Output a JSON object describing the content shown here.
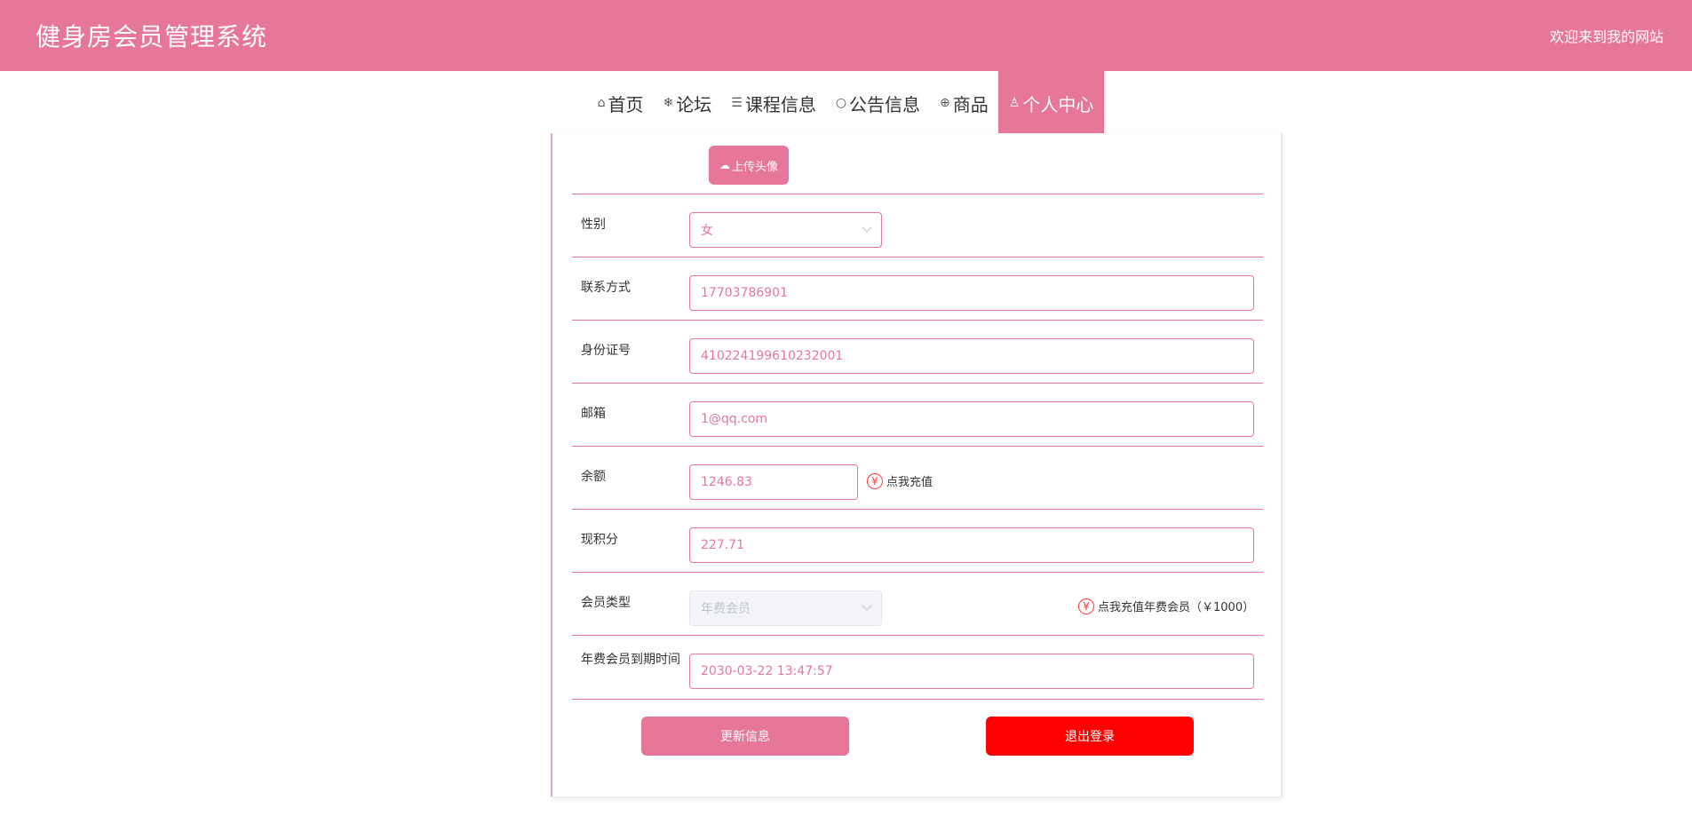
{
  "header": {
    "title": "健身房会员管理系统",
    "welcome": "欢迎来到我的网站"
  },
  "nav": [
    {
      "icon": "⌂",
      "label": "首页"
    },
    {
      "icon": "❄",
      "label": "论坛"
    },
    {
      "icon": "☰",
      "label": "课程信息"
    },
    {
      "icon": "○",
      "label": "公告信息"
    },
    {
      "icon": "⊕",
      "label": "商品"
    },
    {
      "icon": "♙",
      "label": "个人中心"
    }
  ],
  "profile": {
    "upload_label": "上传头像",
    "gender": {
      "label": "性别",
      "value": "女"
    },
    "phone": {
      "label": "联系方式",
      "value": "17703786901"
    },
    "id_card": {
      "label": "身份证号",
      "value": "410224199610232001"
    },
    "email": {
      "label": "邮箱",
      "value": "1@qq.com"
    },
    "balance": {
      "label": "余额",
      "value": "1246.83",
      "recharge": "点我充值"
    },
    "points": {
      "label": "现积分",
      "value": "227.71"
    },
    "member_type": {
      "label": "会员类型",
      "value": "年费会员",
      "recharge": "点我充值年费会员（￥1000）"
    },
    "expire": {
      "label": "年费会员到期时间",
      "value": "2030-03-22 13:47:57"
    }
  },
  "actions": {
    "update": "更新信息",
    "logout": "退出登录"
  },
  "colors": {
    "accent": "#e67798",
    "danger": "#ff0000"
  }
}
